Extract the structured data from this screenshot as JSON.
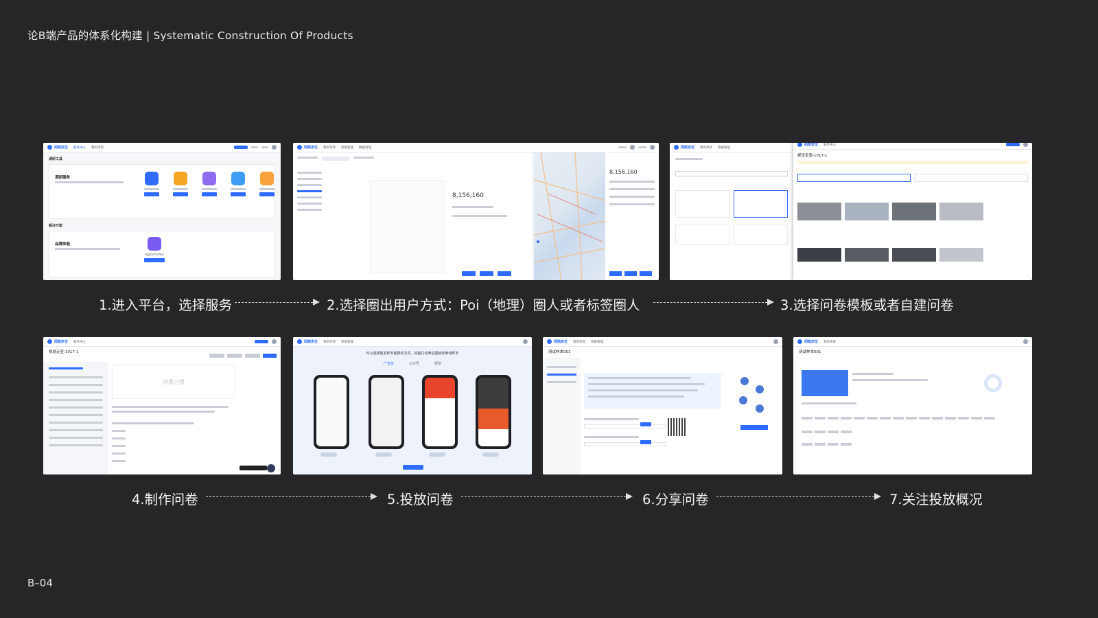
{
  "header": {
    "title": "论B端产品的体系化构建 | Systematic Construction Of Products"
  },
  "steps": {
    "s1": "1.进入平台，选择服务",
    "s2": "2.选择圈出用户方式：Poi（地理）圈人或者标签圈人",
    "s3": "3.选择问卷模板或者自建问卷",
    "s4": "4.制作问卷",
    "s5": "5.投放问卷",
    "s6": "6.分享问卷",
    "s7": "7.关注投放概况"
  },
  "screens": {
    "s1": {
      "section1": "调研工具",
      "service_title": "调研服务",
      "section2": "解决方案",
      "solution_title": "品牌体验",
      "product": "Digital Profiler"
    },
    "s2": {
      "count": "8,156,160"
    },
    "s2b": {
      "count": "8,156,160"
    },
    "s4": {
      "title": "视觉走查-1017-1",
      "placeholder": "消费习惯"
    },
    "s5": {
      "headline": "可以选择能发样本最费的方式，如能打动奉信回给你参询样本",
      "tabs": [
        "广告位",
        "公众号",
        "短信"
      ]
    },
    "s6": {
      "title": "测试样本001"
    },
    "s7": {
      "title": "测试样本001"
    }
  },
  "footer": {
    "page": "B–04"
  },
  "colors": {
    "background": "#262628",
    "accent": "#2f6bff",
    "text": "#f2f2f2"
  }
}
